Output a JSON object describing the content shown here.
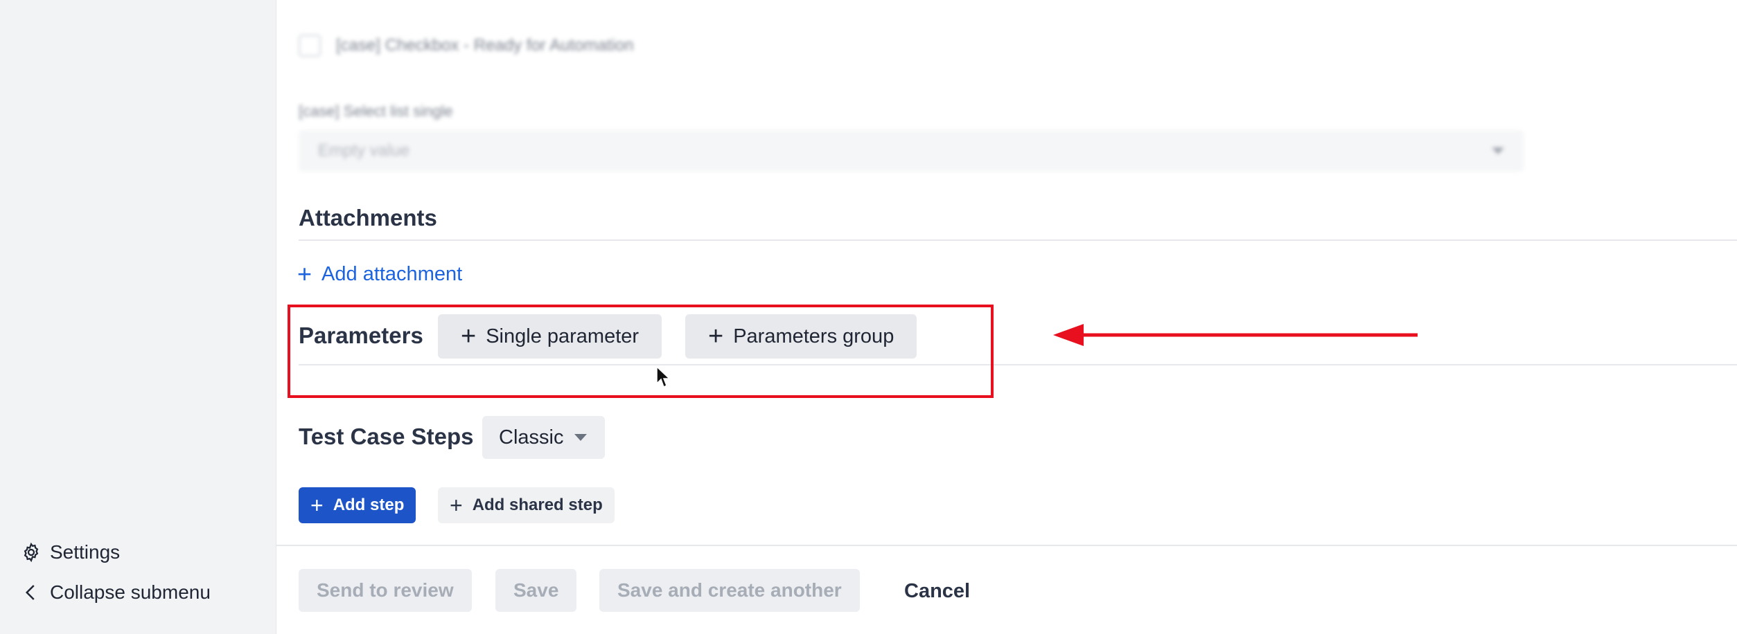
{
  "sidebar": {
    "settings_label": "Settings",
    "collapse_label": "Collapse submenu"
  },
  "form": {
    "checkbox_label": "[case] Checkbox - Ready for Automation",
    "select_label": "[case] Select list single",
    "select_value": "Empty value"
  },
  "attachments": {
    "title": "Attachments",
    "add_label": "Add attachment"
  },
  "parameters": {
    "title": "Parameters",
    "single_label": "Single parameter",
    "group_label": "Parameters group"
  },
  "steps": {
    "title": "Test Case Steps",
    "mode_value": "Classic",
    "add_step_label": "Add step",
    "add_shared_label": "Add shared step"
  },
  "footer": {
    "send_review_label": "Send to review",
    "save_label": "Save",
    "save_another_label": "Save and create another",
    "cancel_label": "Cancel"
  },
  "colors": {
    "accent": "#1c63e0",
    "primary_button": "#1d55c9",
    "annotation": "#e8101e"
  },
  "icons": {
    "settings": "gear-icon",
    "collapse": "chevron-left-icon",
    "plus": "plus-icon",
    "caret": "caret-down-icon"
  }
}
